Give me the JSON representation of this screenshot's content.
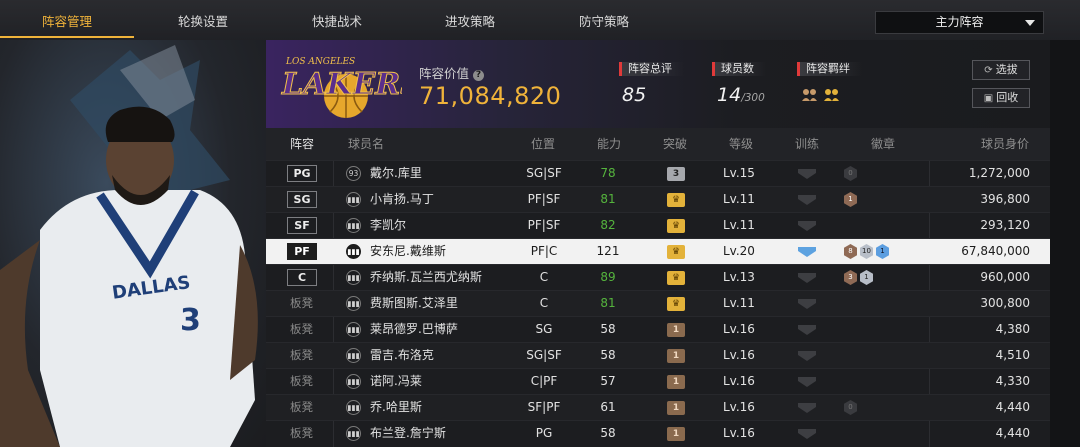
{
  "nav": {
    "tabs": [
      {
        "label": "阵容管理",
        "active": true
      },
      {
        "label": "轮换设置",
        "active": false
      },
      {
        "label": "快捷战术",
        "active": false
      },
      {
        "label": "进攻策略",
        "active": false
      },
      {
        "label": "防守策略",
        "active": false
      }
    ],
    "lineup_select": "主力阵容"
  },
  "team": {
    "logo_text": "LAKERS",
    "logo_subtext": "LOS ANGELES",
    "value_label": "阵容价值",
    "value": "71,084,820",
    "rating_label": "阵容总评",
    "rating": "85",
    "players_label": "球员数",
    "players": "14",
    "players_max": "/300",
    "bond_label": "阵容羁绊",
    "btn_pick": "选拔",
    "btn_recycle": "回收"
  },
  "art": {
    "jersey_word": "DALLAS",
    "jersey_number": "3"
  },
  "table": {
    "headers": [
      "阵容",
      "球员名",
      "位置",
      "能力",
      "突破",
      "等级",
      "训练",
      "徽章",
      "球员身价"
    ],
    "rows": [
      {
        "slot": "PG",
        "starter": true,
        "jersey": "93",
        "name": "戴尔.库里",
        "pos": "SG|SF",
        "ability": "78",
        "green": true,
        "breakthrough": "3",
        "btype": "gray",
        "level": "Lv.15",
        "train": false,
        "badges": [
          {
            "t": "0",
            "c": "dim"
          }
        ],
        "salary": "1,272,000"
      },
      {
        "slot": "SG",
        "starter": true,
        "jersey": "",
        "name": "小肯扬.马丁",
        "pos": "PF|SF",
        "ability": "81",
        "green": true,
        "breakthrough": "♛",
        "btype": "gold",
        "level": "Lv.11",
        "train": false,
        "badges": [
          {
            "t": "1",
            "c": "bronze"
          }
        ],
        "salary": "396,800"
      },
      {
        "slot": "SF",
        "starter": true,
        "jersey": "",
        "name": "李凯尔",
        "pos": "PF|SF",
        "ability": "82",
        "green": true,
        "breakthrough": "♛",
        "btype": "gold",
        "level": "Lv.11",
        "train": false,
        "badges": [],
        "salary": "293,120"
      },
      {
        "slot": "PF",
        "starter": true,
        "selected": true,
        "jersey": "",
        "name": "安东尼.戴维斯",
        "pos": "PF|C",
        "ability": "121",
        "green": false,
        "breakthrough": "♛",
        "btype": "gold",
        "level": "Lv.20",
        "train": true,
        "badges": [
          {
            "t": "8",
            "c": "bronze"
          },
          {
            "t": "10",
            "c": "silver"
          },
          {
            "t": "1",
            "c": "blue"
          }
        ],
        "salary": "67,840,000"
      },
      {
        "slot": "C",
        "starter": true,
        "jersey": "",
        "name": "乔纳斯.瓦兰西尤纳斯",
        "pos": "C",
        "ability": "89",
        "green": true,
        "breakthrough": "♛",
        "btype": "gold",
        "level": "Lv.13",
        "train": false,
        "badges": [
          {
            "t": "3",
            "c": "bronze"
          },
          {
            "t": "1",
            "c": "silver"
          }
        ],
        "salary": "960,000"
      },
      {
        "slot": "板凳",
        "starter": false,
        "jersey": "",
        "name": "费斯图斯.艾泽里",
        "pos": "C",
        "ability": "81",
        "green": true,
        "breakthrough": "♛",
        "btype": "gold",
        "level": "Lv.11",
        "train": false,
        "badges": [],
        "salary": "300,800"
      },
      {
        "slot": "板凳",
        "starter": false,
        "jersey": "",
        "name": "莱昂德罗.巴博萨",
        "pos": "SG",
        "ability": "58",
        "green": false,
        "breakthrough": "1",
        "btype": "bronze",
        "level": "Lv.16",
        "train": false,
        "badges": [],
        "salary": "4,380"
      },
      {
        "slot": "板凳",
        "starter": false,
        "jersey": "",
        "name": "雷吉.布洛克",
        "pos": "SG|SF",
        "ability": "58",
        "green": false,
        "breakthrough": "1",
        "btype": "bronze",
        "level": "Lv.16",
        "train": false,
        "badges": [],
        "salary": "4,510"
      },
      {
        "slot": "板凳",
        "starter": false,
        "jersey": "",
        "name": "诺阿.冯莱",
        "pos": "C|PF",
        "ability": "57",
        "green": false,
        "breakthrough": "1",
        "btype": "bronze",
        "level": "Lv.16",
        "train": false,
        "badges": [],
        "salary": "4,330"
      },
      {
        "slot": "板凳",
        "starter": false,
        "jersey": "",
        "name": "乔.哈里斯",
        "pos": "SF|PF",
        "ability": "61",
        "green": false,
        "breakthrough": "1",
        "btype": "bronze",
        "level": "Lv.16",
        "train": false,
        "badges": [
          {
            "t": "0",
            "c": "dim"
          }
        ],
        "salary": "4,440"
      },
      {
        "slot": "板凳",
        "starter": false,
        "jersey": "",
        "name": "布兰登.詹宁斯",
        "pos": "PG",
        "ability": "58",
        "green": false,
        "breakthrough": "1",
        "btype": "bronze",
        "level": "Lv.16",
        "train": false,
        "badges": [],
        "salary": "4,440"
      }
    ]
  }
}
